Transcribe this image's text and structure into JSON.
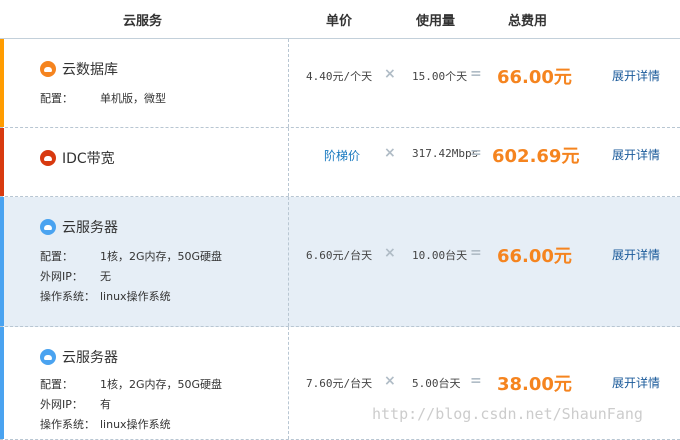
{
  "header": {
    "service": "云服务",
    "unit_price": "单价",
    "usage": "使用量",
    "total": "总费用"
  },
  "rows": [
    {
      "name": "云数据库",
      "icon_color": "#f5841f",
      "bar_color": "#ff9c00",
      "specs": [
        {
          "label": "配置：",
          "value": "单机版，微型"
        }
      ],
      "price": "4.40元/个天",
      "usage": "15.00个天",
      "total": "66.00元",
      "detail": "展开详情"
    },
    {
      "name": "IDC带宽",
      "icon_color": "#d83a10",
      "bar_color": "#d83a10",
      "specs": [],
      "price": "阶梯价",
      "usage": "317.42Mbps",
      "total": "602.69元",
      "detail": "展开详情"
    },
    {
      "name": "云服务器",
      "icon_color": "#4aa3f0",
      "bar_color": "#4aa3f0",
      "specs": [
        {
          "label": "配置：",
          "value": "1核，2G内存，50G硬盘"
        },
        {
          "label": "外网IP：",
          "value": "无"
        },
        {
          "label": "操作系统：",
          "value": "linux操作系统"
        }
      ],
      "price": "6.60元/台天",
      "usage": "10.00台天",
      "total": "66.00元",
      "detail": "展开详情"
    },
    {
      "name": "云服务器",
      "icon_color": "#4aa3f0",
      "bar_color": "#4aa3f0",
      "specs": [
        {
          "label": "配置：",
          "value": "1核，2G内存，50G硬盘"
        },
        {
          "label": "外网IP：",
          "value": "有"
        },
        {
          "label": "操作系统：",
          "value": "linux操作系统"
        }
      ],
      "price": "7.60元/台天",
      "usage": "5.00台天",
      "total": "38.00元",
      "detail": "展开详情"
    }
  ],
  "symbols": {
    "times": "×",
    "equals": "="
  },
  "watermark": "http://blog.csdn.net/ShaunFang"
}
